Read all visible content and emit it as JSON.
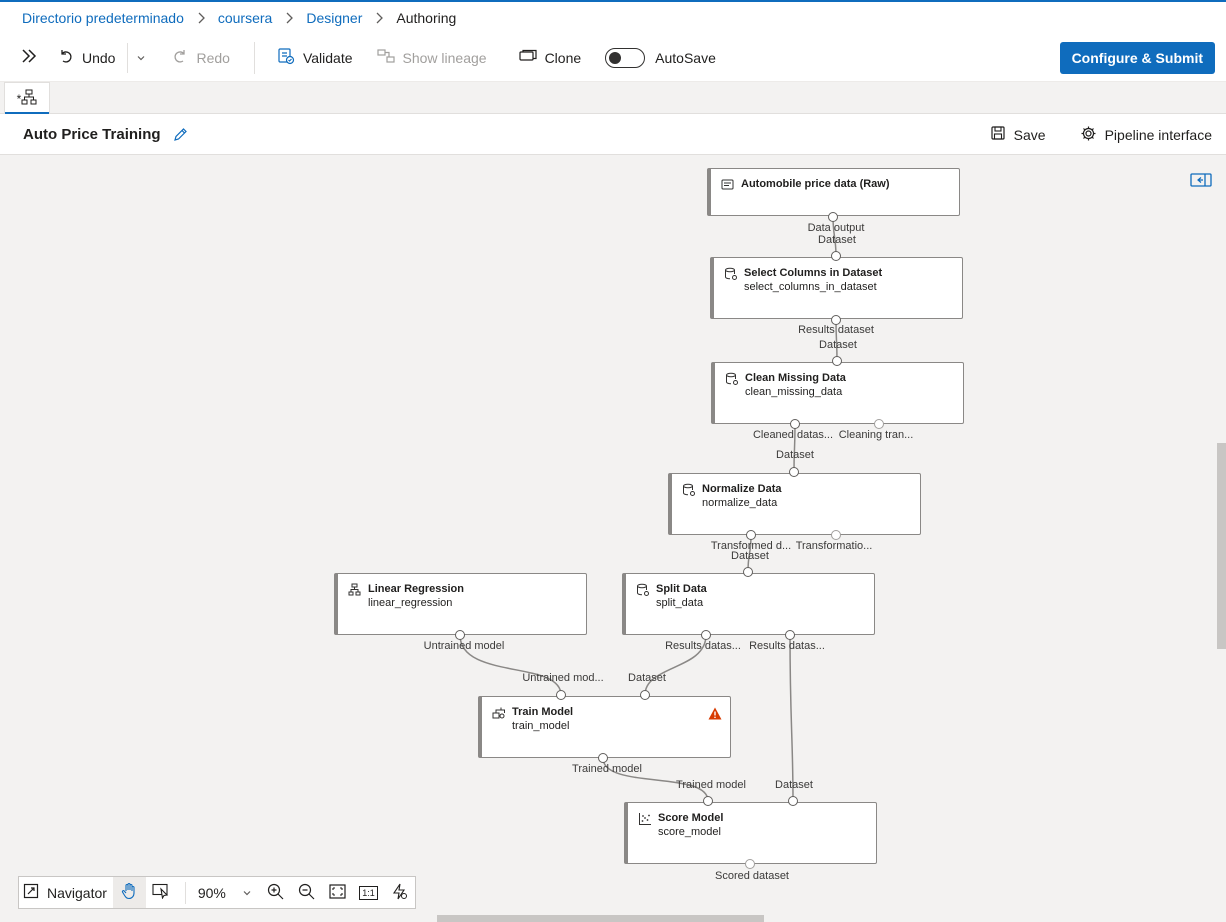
{
  "breadcrumb": {
    "items": [
      "Directorio predeterminado",
      "coursera",
      "Designer"
    ],
    "current": "Authoring"
  },
  "toolbar": {
    "undo": "Undo",
    "redo": "Redo",
    "validate": "Validate",
    "show_lineage": "Show lineage",
    "clone": "Clone",
    "autosave": "AutoSave",
    "autosave_on": false,
    "submit": "Configure & Submit"
  },
  "tab": {
    "label": "*"
  },
  "pipeline": {
    "title": "Auto Price Training",
    "save": "Save",
    "interface": "Pipeline interface"
  },
  "nodes": {
    "automobile": {
      "title": "Automobile price data (Raw)",
      "subtitle": ""
    },
    "select_columns": {
      "title": "Select Columns in Dataset",
      "subtitle": "select_columns_in_dataset"
    },
    "clean_missing": {
      "title": "Clean Missing Data",
      "subtitle": "clean_missing_data"
    },
    "normalize": {
      "title": "Normalize Data",
      "subtitle": "normalize_data"
    },
    "linear_regression": {
      "title": "Linear Regression",
      "subtitle": "linear_regression"
    },
    "split": {
      "title": "Split Data",
      "subtitle": "split_data"
    },
    "train": {
      "title": "Train Model",
      "subtitle": "train_model"
    },
    "score": {
      "title": "Score Model",
      "subtitle": "score_model"
    }
  },
  "ports": {
    "automobile_out": "Data output",
    "select_in": "Dataset",
    "select_out": "Results dataset",
    "clean_in": "Dataset",
    "clean_out1": "Cleaned datas...",
    "clean_out2": "Cleaning tran...",
    "normalize_in": "Dataset",
    "normalize_out1": "Transformed d...",
    "normalize_out2": "Transformatio...",
    "split_in": "Dataset",
    "lr_out": "Untrained model",
    "split_out1": "Results datas...",
    "split_out2": "Results datas...",
    "train_in1": "Untrained mod...",
    "train_in2": "Dataset",
    "train_out": "Trained model",
    "score_in1": "Trained model",
    "score_in2": "Dataset",
    "score_out": "Scored dataset"
  },
  "navigator": {
    "label": "Navigator",
    "zoom": "90%",
    "fit_label": "1:1"
  },
  "colors": {
    "accent": "#0f6cbd",
    "warning": "#d83b01"
  }
}
